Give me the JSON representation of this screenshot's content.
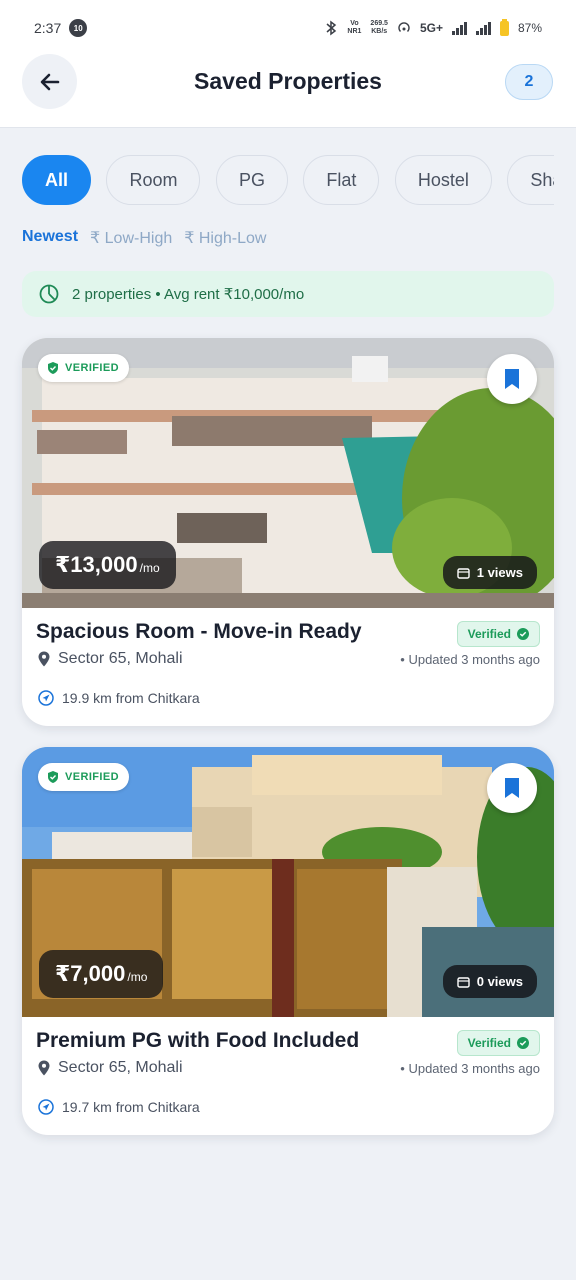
{
  "status_bar": {
    "time": "2:37",
    "notification_badge": "10",
    "network_speed_top": "269.5",
    "network_speed_bottom": "KB/s",
    "volte_top": "Vo",
    "volte_bottom": "NR1",
    "network_type": "5G+",
    "battery": "87%"
  },
  "header": {
    "title": "Saved Properties",
    "count": "2"
  },
  "filters": [
    {
      "label": "All",
      "active": true
    },
    {
      "label": "Room",
      "active": false
    },
    {
      "label": "PG",
      "active": false
    },
    {
      "label": "Flat",
      "active": false
    },
    {
      "label": "Hostel",
      "active": false
    },
    {
      "label": "Share",
      "active": false
    }
  ],
  "sort": {
    "newest": "Newest",
    "low_high": "₹ Low-High",
    "high_low": "₹ High-Low"
  },
  "summary": "2 properties • Avg rent ₹10,000/mo",
  "properties": [
    {
      "verified_label": "VERIFIED",
      "price": "₹13,000",
      "price_unit": "/mo",
      "views": "1 views",
      "title": "Spacious Room - Move-in Ready",
      "verified_tag": "Verified",
      "location": "Sector 65, Mohali",
      "updated": "• Updated 3 months ago",
      "distance": "19.9 km from Chitkara"
    },
    {
      "verified_label": "VERIFIED",
      "price": "₹7,000",
      "price_unit": "/mo",
      "views": "0 views",
      "title": "Premium PG with Food Included",
      "verified_tag": "Verified",
      "location": "Sector 65, Mohali",
      "updated": "• Updated 3 months ago",
      "distance": "19.7 km from Chitkara"
    }
  ],
  "colors": {
    "accent": "#1a86f0",
    "verified_green": "#1c9b5a",
    "background": "#eef1f6"
  }
}
